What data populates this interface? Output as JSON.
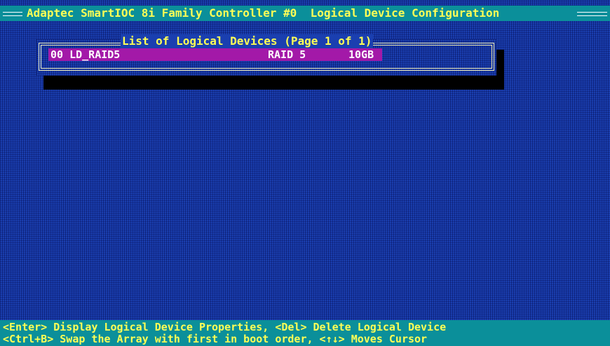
{
  "header": {
    "title": "Adaptec SmartIOC 8i Family Controller #0  Logical Device Configuration"
  },
  "list": {
    "title": "List of Logical Devices (Page 1 of 1)",
    "items": [
      {
        "name": "00 LD_RAID5",
        "raid_level": "RAID 5",
        "size": "10GB"
      }
    ]
  },
  "footer": {
    "line1": "<Enter> Display Logical Device Properties, <Del> Delete Logical Device",
    "line2": "<Ctrl+B> Swap the Array with first in boot order, <↑↓> Moves Cursor"
  },
  "colors": {
    "background": "#1a3fb0",
    "bar": "#0b8f9a",
    "highlight": "#a319a8",
    "text_yellow": "#ffff55",
    "text_white": "#ffffff"
  }
}
